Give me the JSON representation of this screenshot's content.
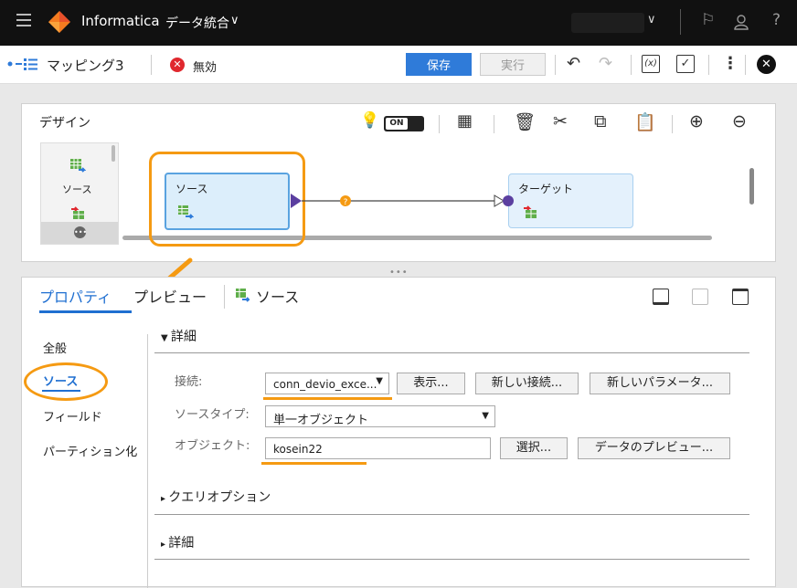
{
  "topbar": {
    "brand": "Informatica",
    "product": "データ統合",
    "icons": [
      "flag-icon",
      "user-icon",
      "help-icon"
    ],
    "help_label": "?"
  },
  "toolbar": {
    "mapping_name": "マッピング3",
    "status": "無効",
    "save_label": "保存",
    "run_label": "実行",
    "icons": [
      "undo-icon",
      "redo-icon",
      "formula-icon",
      "validate-icon",
      "more-icon",
      "close-icon"
    ]
  },
  "design": {
    "title": "デザイン",
    "toggle_label": "ON",
    "palette_item": "ソース",
    "source_node": "ソース",
    "target_node": "ターゲット"
  },
  "properties": {
    "tabs": [
      "プロパティ",
      "プレビュー",
      "ソース"
    ],
    "nav": [
      "全般",
      "ソース",
      "フィールド",
      "パーティション化"
    ],
    "section_detail": "詳細",
    "connection_label": "接続:",
    "connection_value": "conn_devio_exce...",
    "show_button": "表示...",
    "new_connection_button": "新しい接続...",
    "new_parameter_button": "新しいパラメータ...",
    "source_type_label": "ソースタイプ:",
    "source_type_value": "単一オブジェクト",
    "object_label": "オブジェクト:",
    "object_value": "kosein22",
    "select_button": "選択...",
    "preview_button": "データのプレビュー...",
    "query_options": "クエリオプション",
    "section_detail2": "詳細"
  },
  "colors": {
    "accent": "#1f6fd1",
    "highlight": "#f59a12",
    "save_button": "#2f7bd9",
    "error": "#e0282e"
  }
}
